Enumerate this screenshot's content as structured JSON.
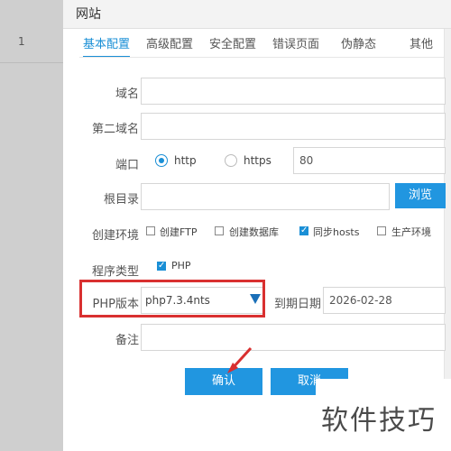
{
  "background": {
    "row_number": "1"
  },
  "dialog": {
    "title": "网站",
    "tabs": [
      {
        "label": "基本配置"
      },
      {
        "label": "高级配置"
      },
      {
        "label": "安全配置"
      },
      {
        "label": "错误页面"
      },
      {
        "label": "伪静态"
      },
      {
        "label": "其他"
      }
    ],
    "form": {
      "domain_label": "域名",
      "domain_value": "",
      "second_domain_label": "第二域名",
      "second_domain_value": "",
      "port_label": "端口",
      "protocol_http": "http",
      "protocol_https": "https",
      "port_value": "80",
      "root_label": "根目录",
      "root_value": "",
      "browse_label": "浏览",
      "env_label": "创建环境",
      "env_options": [
        {
          "label": "创建FTP",
          "checked": false
        },
        {
          "label": "创建数据库",
          "checked": false
        },
        {
          "label": "同步hosts",
          "checked": true
        },
        {
          "label": "生产环境",
          "checked": false
        }
      ],
      "program_type_label": "程序类型",
      "program_type_option": "PHP",
      "php_version_label": "PHP版本",
      "php_version_value": "php7.3.4nts",
      "expire_label": "到期日期",
      "expire_value": "2026-02-28",
      "remark_label": "备注",
      "remark_value": ""
    },
    "buttons": {
      "confirm": "确认",
      "cancel": "取消"
    }
  },
  "watermark": "软件技巧",
  "colors": {
    "accent": "#2196e0",
    "highlight": "#d93030"
  }
}
